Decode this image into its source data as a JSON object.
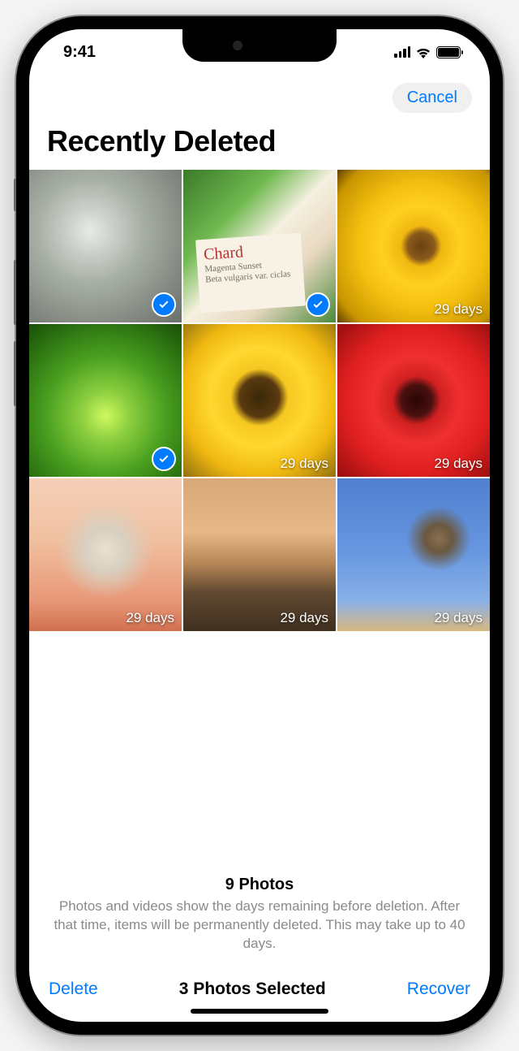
{
  "statusBar": {
    "time": "9:41"
  },
  "nav": {
    "cancel": "Cancel"
  },
  "title": "Recently Deleted",
  "chardLabel": {
    "line1": "Chard",
    "line2": "Magenta Sunset",
    "line3": "Beta vulgaris var. ciclas"
  },
  "photos": [
    {
      "selected": true,
      "daysLabel": ""
    },
    {
      "selected": true,
      "daysLabel": ""
    },
    {
      "selected": false,
      "daysLabel": "29 days"
    },
    {
      "selected": true,
      "daysLabel": ""
    },
    {
      "selected": false,
      "daysLabel": "29 days"
    },
    {
      "selected": false,
      "daysLabel": "29 days"
    },
    {
      "selected": false,
      "daysLabel": "29 days"
    },
    {
      "selected": false,
      "daysLabel": "29 days"
    },
    {
      "selected": false,
      "daysLabel": "29 days"
    }
  ],
  "summary": {
    "count": "9 Photos",
    "desc": "Photos and videos show the days remaining before deletion. After that time, items will be permanently deleted. This may take up to 40 days."
  },
  "toolbar": {
    "delete": "Delete",
    "selected": "3 Photos Selected",
    "recover": "Recover"
  }
}
